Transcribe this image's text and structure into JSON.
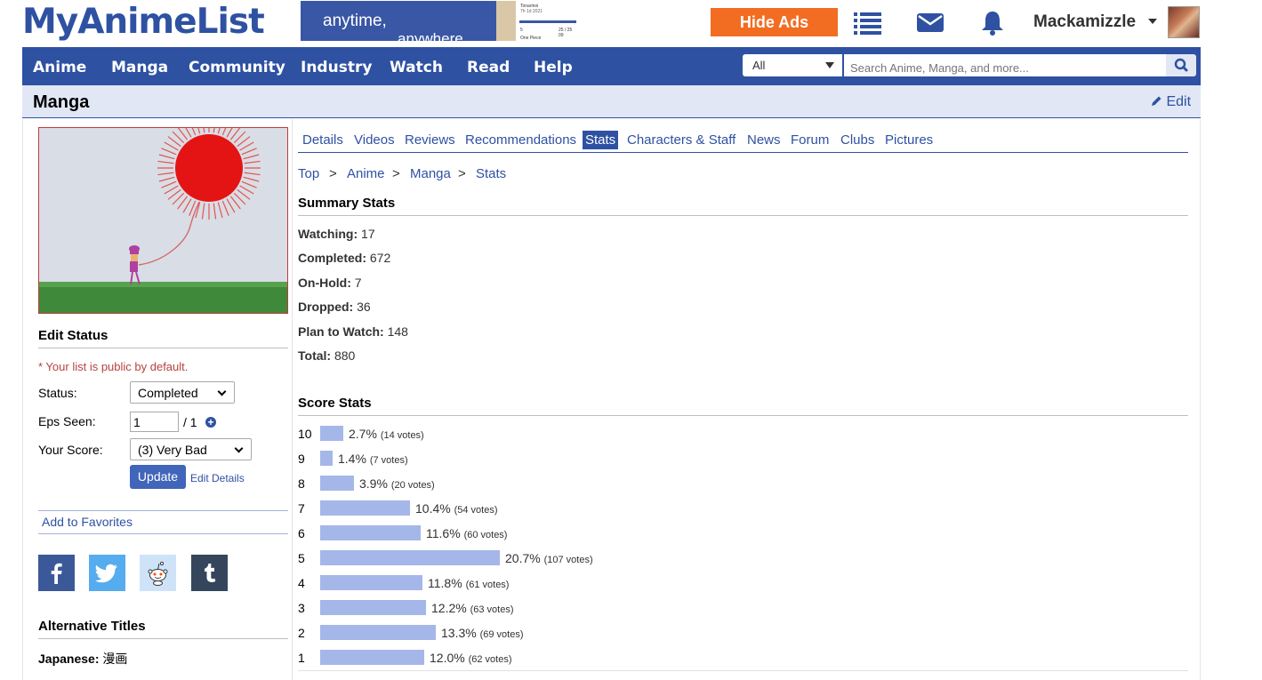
{
  "header": {
    "logo": "MyAnimeList",
    "ad": {
      "line1": "anytime,",
      "line2": "anywhere",
      "t1": "Tonarinoi",
      "t2": "7h 1d 2021",
      "t3": "5",
      "t4": "25 / 25 09",
      "t5": "One Piece"
    },
    "hide_ads": "Hide Ads",
    "username": "Mackamizzle"
  },
  "nav": {
    "items": [
      "Anime",
      "Manga",
      "Community",
      "Industry",
      "Watch",
      "Read",
      "Help"
    ],
    "search_type": "All",
    "search_placeholder": "Search Anime, Manga, and more..."
  },
  "page": {
    "title": "Manga",
    "edit_label": "Edit"
  },
  "tabs": [
    "Details",
    "Videos",
    "Reviews",
    "Recommendations",
    "Stats",
    "Characters & Staff",
    "News",
    "Forum",
    "Clubs",
    "Pictures"
  ],
  "active_tab": "Stats",
  "breadcrumb": [
    "Top",
    "Anime",
    "Manga",
    "Stats"
  ],
  "breadcrumb_sep": ">",
  "edit_status": {
    "title": "Edit Status",
    "note": "* Your list is public by default.",
    "status_label": "Status:",
    "status_value": "Completed",
    "eps_label": "Eps Seen:",
    "eps_value": "1",
    "eps_total": "/ 1",
    "score_label": "Your Score:",
    "score_value": "(3) Very Bad",
    "update_button": "Update",
    "edit_details": "Edit Details",
    "add_favorites": "Add to Favorites"
  },
  "alt_titles": {
    "title": "Alternative Titles",
    "japanese_label": "Japanese:",
    "japanese_value": "漫画"
  },
  "summary": {
    "title": "Summary Stats",
    "rows": [
      {
        "label": "Watching:",
        "value": "17"
      },
      {
        "label": "Completed:",
        "value": "672"
      },
      {
        "label": "On-Hold:",
        "value": "7"
      },
      {
        "label": "Dropped:",
        "value": "36"
      },
      {
        "label": "Plan to Watch:",
        "value": "148"
      },
      {
        "label": "Total:",
        "value": "880"
      }
    ]
  },
  "score_stats": {
    "title": "Score Stats",
    "rows": [
      {
        "score": "10",
        "pct": "2.7%",
        "votes": "(14 votes)",
        "fraction": 0.027
      },
      {
        "score": "9",
        "pct": "1.4%",
        "votes": "(7 votes)",
        "fraction": 0.014
      },
      {
        "score": "8",
        "pct": "3.9%",
        "votes": "(20 votes)",
        "fraction": 0.039
      },
      {
        "score": "7",
        "pct": "10.4%",
        "votes": "(54 votes)",
        "fraction": 0.104
      },
      {
        "score": "6",
        "pct": "11.6%",
        "votes": "(60 votes)",
        "fraction": 0.116
      },
      {
        "score": "5",
        "pct": "20.7%",
        "votes": "(107 votes)",
        "fraction": 0.207
      },
      {
        "score": "4",
        "pct": "11.8%",
        "votes": "(61 votes)",
        "fraction": 0.118
      },
      {
        "score": "3",
        "pct": "12.2%",
        "votes": "(63 votes)",
        "fraction": 0.122
      },
      {
        "score": "2",
        "pct": "13.3%",
        "votes": "(69 votes)",
        "fraction": 0.133
      },
      {
        "score": "1",
        "pct": "12.0%",
        "votes": "(62 votes)",
        "fraction": 0.12
      }
    ]
  },
  "colors": {
    "brand": "#2e51a2",
    "accent": "#f26d21",
    "bar": "#a5b7e8",
    "note": "#b6433f"
  }
}
